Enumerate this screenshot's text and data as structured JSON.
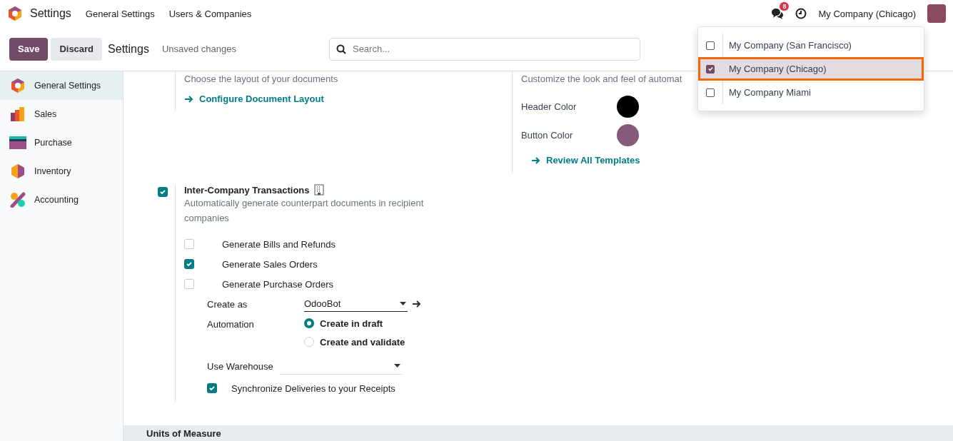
{
  "navbar": {
    "app_title": "Settings",
    "menus": [
      "General Settings",
      "Users & Companies"
    ],
    "messages_badge": "8",
    "company": "My Company (Chicago)"
  },
  "control_panel": {
    "save": "Save",
    "discard": "Discard",
    "breadcrumb": "Settings",
    "status": "Unsaved changes",
    "search": {
      "placeholder": "Search..."
    }
  },
  "company_menu": [
    {
      "label": "My Company (San Francisco)",
      "checked": false,
      "selected": false
    },
    {
      "label": "My Company (Chicago)",
      "checked": true,
      "selected": true
    },
    {
      "label": "My Company Miami",
      "checked": false,
      "selected": false
    }
  ],
  "sidebar": {
    "items": [
      {
        "label": "General Settings",
        "kind": "general",
        "selected": true
      },
      {
        "label": "Sales",
        "kind": "sales",
        "selected": false
      },
      {
        "label": "Purchase",
        "kind": "purchase",
        "selected": false
      },
      {
        "label": "Inventory",
        "kind": "inventory",
        "selected": false
      },
      {
        "label": "Accounting",
        "kind": "accounting",
        "selected": false
      }
    ]
  },
  "document_layout": {
    "description": "Choose the layout of your documents",
    "link": "Configure Document Layout"
  },
  "email_templates": {
    "description": "Customize the look and feel of automat",
    "colors": [
      {
        "label": "Header Color",
        "color": "#000000"
      },
      {
        "label": "Button Color",
        "color": "#875a7b"
      }
    ],
    "link": "Review All Templates"
  },
  "inter_company": {
    "checked": true,
    "title": "Inter-Company Transactions",
    "description": "Automatically generate counterpart documents in recipient companies",
    "options": [
      {
        "label": "Generate Bills and Refunds",
        "checked": false
      },
      {
        "label": "Generate Sales Orders",
        "checked": true
      },
      {
        "label": "Generate Purchase Orders",
        "checked": false
      }
    ],
    "create_as": {
      "label": "Create as",
      "value": "OdooBot"
    },
    "automation": {
      "label": "Automation",
      "options": [
        {
          "label": "Create in draft",
          "selected": true
        },
        {
          "label": "Create and validate",
          "selected": false
        }
      ]
    },
    "use_warehouse": {
      "label": "Use Warehouse"
    },
    "sync": {
      "label": "Synchronize Deliveries to your Receipts",
      "checked": true
    }
  },
  "next_section": {
    "title": "Units of Measure"
  }
}
